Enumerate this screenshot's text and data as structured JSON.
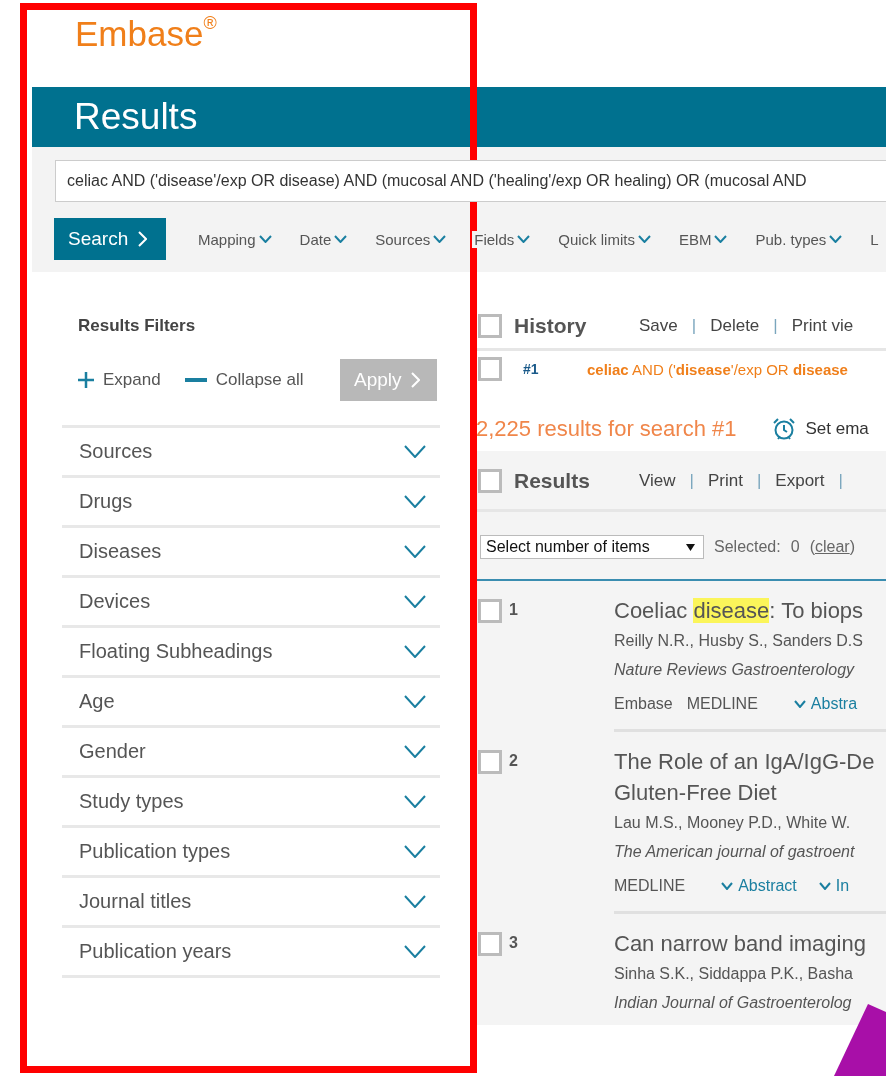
{
  "logo": {
    "text": "Embase$^{®}$"
  },
  "header": {
    "title": "Results"
  },
  "search": {
    "query": "celiac AND ('disease'/exp OR disease) AND (mucosal AND ('healing'/exp OR healing) OR (mucosal AND",
    "button": "Search",
    "options": [
      {
        "label": "Mapping",
        "chevron": true
      },
      {
        "label": "Date",
        "chevron": true
      },
      {
        "label": "Sources",
        "chevron": true
      },
      {
        "label": "Fields",
        "chevron": true
      },
      {
        "label": "Quick limits",
        "chevron": true
      },
      {
        "label": "EBM",
        "chevron": true
      },
      {
        "label": "Pub. types",
        "chevron": true
      },
      {
        "label": "L",
        "chevron": false
      }
    ]
  },
  "filters": {
    "title": "Results Filters",
    "expand": "Expand",
    "collapse": "Collapse all",
    "apply": {
      "label": "Apply",
      "disabled": true
    },
    "items": [
      {
        "label": "Sources",
        "expanded": false
      },
      {
        "label": "Drugs",
        "expanded": false
      },
      {
        "label": "Diseases",
        "expanded": false
      },
      {
        "label": "Devices",
        "expanded": false
      },
      {
        "label": "Floating Subheadings",
        "expanded": false
      },
      {
        "label": "Age",
        "expanded": false
      },
      {
        "label": "Gender",
        "expanded": false
      },
      {
        "label": "Study types",
        "expanded": false
      },
      {
        "label": "Publication types",
        "expanded": false
      },
      {
        "label": "Journal titles",
        "expanded": false
      },
      {
        "label": "Publication years",
        "expanded": false
      }
    ]
  },
  "history": {
    "title": "History",
    "checked": false,
    "actions": [
      {
        "kind": "link",
        "text": "Save"
      },
      {
        "kind": "separator",
        "text": "|"
      },
      {
        "kind": "link",
        "text": "Delete"
      },
      {
        "kind": "separator",
        "text": "|"
      },
      {
        "kind": "link",
        "text": "Print vie"
      }
    ],
    "entries": [
      {
        "number": "#1",
        "query": "**celiac** AND ('**disease**'/exp OR **disease**",
        "checked": false
      }
    ]
  },
  "results": {
    "count": "2,225 results for search #1",
    "alert": "Set ema",
    "title": "Results",
    "checked": false,
    "actions": [
      {
        "kind": "link",
        "text": "View"
      },
      {
        "kind": "separator",
        "text": "|"
      },
      {
        "kind": "link",
        "text": "Print"
      },
      {
        "kind": "separator",
        "text": "|"
      },
      {
        "kind": "link",
        "text": "Export"
      },
      {
        "kind": "separator",
        "text": "|"
      }
    ],
    "select": {
      "value": "Select number of items"
    },
    "selected_label": "Selected:",
    "selected_count": "0",
    "clear_open": "(",
    "clear": "clear",
    "clear_close": ")",
    "items": [
      {
        "number": "1",
        "checked": false,
        "title": [
          [
            {
              "text": "Coeliac ",
              "highlighted": false
            },
            {
              "text": "disease",
              "highlighted": true
            },
            {
              "text": ": To biops",
              "highlighted": false
            }
          ]
        ],
        "authors": "Reilly N.R., Husby S., Sanders D.S",
        "journal": "Nature Reviews Gastroenterology",
        "sources": [
          "Embase",
          "MEDLINE"
        ],
        "links": [
          "Abstra"
        ]
      },
      {
        "number": "2",
        "checked": false,
        "title": [
          [
            {
              "text": "The Role of an IgA/IgG-De",
              "highlighted": false
            }
          ],
          [
            {
              "text": "Gluten-Free Diet",
              "highlighted": false
            }
          ]
        ],
        "authors": "Lau M.S., Mooney P.D., White W.",
        "journal": "The American journal of gastroent",
        "sources": [
          "MEDLINE"
        ],
        "links": [
          "Abstract",
          "In"
        ]
      },
      {
        "number": "3",
        "checked": false,
        "title": [
          [
            {
              "text": "Can narrow band imaging",
              "highlighted": false
            }
          ]
        ],
        "authors": "Sinha S.K., Siddappa P.K., Basha",
        "journal": "Indian Journal of Gastroenterolog"
      }
    ]
  },
  "annotations": [
    {
      "kind": "frame",
      "color": "#ff0000"
    },
    {
      "kind": "wedge",
      "color": "#a80fa8"
    }
  ]
}
